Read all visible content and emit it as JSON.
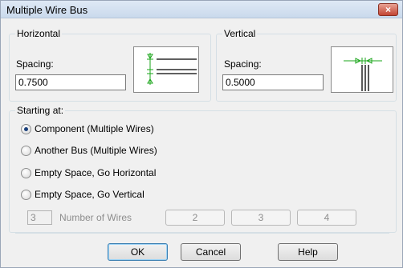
{
  "window": {
    "title": "Multiple Wire Bus",
    "close_glyph": "×"
  },
  "horizontal": {
    "legend": "Horizontal",
    "spacing_label": "Spacing:",
    "spacing_value": "0.7500",
    "preview_icon": "horizontal-wire-spacing-icon"
  },
  "vertical": {
    "legend": "Vertical",
    "spacing_label": "Spacing:",
    "spacing_value": "0.5000",
    "preview_icon": "vertical-wire-spacing-icon"
  },
  "starting": {
    "legend": "Starting at:",
    "options": [
      {
        "label": "Component (Multiple Wires)",
        "checked": true
      },
      {
        "label": "Another Bus (Multiple Wires)",
        "checked": false
      },
      {
        "label": "Empty Space, Go Horizontal",
        "checked": false
      },
      {
        "label": "Empty Space, Go Vertical",
        "checked": false
      }
    ],
    "wire_count": "3",
    "wire_count_label": "Number of Wires",
    "preset_buttons": [
      "2",
      "3",
      "4"
    ]
  },
  "buttons": {
    "ok": "OK",
    "cancel": "Cancel",
    "help": "Help"
  },
  "colors": {
    "accent_green": "#1aa51a",
    "close_red": "#c24534"
  }
}
